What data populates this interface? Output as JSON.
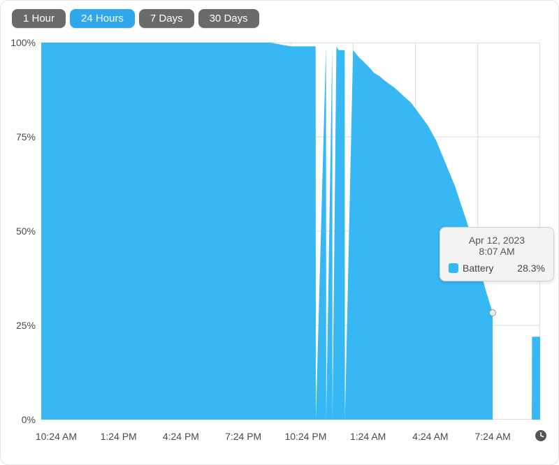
{
  "segments": {
    "items": [
      {
        "label": "1 Hour",
        "active": false
      },
      {
        "label": "24 Hours",
        "active": true
      },
      {
        "label": "7 Days",
        "active": false
      },
      {
        "label": "30 Days",
        "active": false
      }
    ]
  },
  "tooltip": {
    "date": "Apr 12, 2023",
    "time": "8:07 AM",
    "series_label": "Battery",
    "value": "28.3%"
  },
  "colors": {
    "series": "#37b8f5",
    "grid": "#dcdcdc"
  },
  "chart_data": {
    "type": "area",
    "title": "",
    "xlabel": "",
    "ylabel": "",
    "ylim": [
      0,
      100
    ],
    "y_ticks": [
      0,
      25,
      50,
      75,
      100
    ],
    "x_tick_labels": [
      "10:24 AM",
      "1:24 PM",
      "4:24 PM",
      "7:24 PM",
      "10:24 PM",
      "1:24 AM",
      "4:24 AM",
      "7:24 AM"
    ],
    "x_range_hours": [
      0,
      24
    ],
    "series": [
      {
        "name": "Battery",
        "color": "#37b8f5",
        "x_hours": [
          0,
          1,
          2,
          3,
          4,
          5,
          6,
          7,
          8,
          9,
          10,
          11,
          12,
          13,
          13.2,
          13.21,
          13.7,
          13.71,
          14,
          14.01,
          14.2,
          14.3,
          14.6,
          14.61,
          15,
          15.3,
          15.5,
          15.85,
          16,
          16.3,
          16.5,
          17,
          17.4,
          17.8,
          18.2,
          18.6,
          19,
          19.3,
          19.6,
          19.9,
          20.2,
          20.5,
          20.8,
          21.1,
          21.4,
          21.717,
          21.718,
          23.6,
          23.61,
          24
        ],
        "y_pct": [
          100,
          100,
          100,
          100,
          100,
          100,
          100,
          100,
          100,
          100,
          100,
          100,
          99,
          99,
          99,
          0,
          99,
          0,
          99,
          0,
          99,
          98,
          98,
          0,
          98,
          96,
          95,
          93,
          92,
          91,
          90,
          88,
          86,
          84,
          81,
          78,
          74,
          70,
          66,
          62,
          57,
          52,
          46,
          40,
          34,
          28.3,
          0,
          0,
          22,
          22
        ]
      }
    ],
    "hover_point": {
      "x_hours": 21.717,
      "y_pct": 28.3
    }
  }
}
